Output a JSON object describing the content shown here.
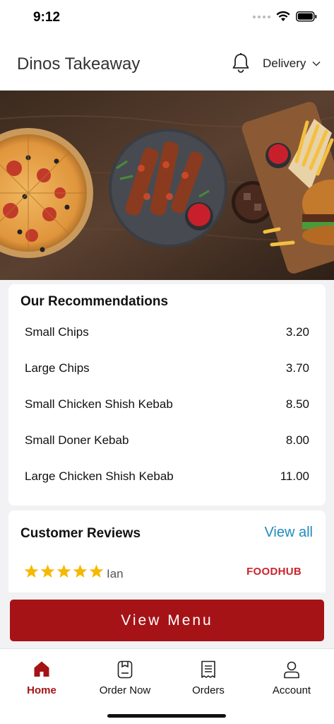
{
  "status_bar": {
    "time": "9:12"
  },
  "header": {
    "title": "Dinos Takeaway",
    "delivery_label": "Delivery"
  },
  "recommendations": {
    "title": "Our Recommendations",
    "items": [
      {
        "name": "Small Chips",
        "price": "3.20"
      },
      {
        "name": "Large Chips",
        "price": "3.70"
      },
      {
        "name": "Small Chicken Shish Kebab",
        "price": "8.50"
      },
      {
        "name": "Small Doner Kebab",
        "price": "8.00"
      },
      {
        "name": "Large Chicken Shish Kebab",
        "price": "11.00"
      }
    ]
  },
  "reviews": {
    "title": "Customer Reviews",
    "view_all_label": "View all",
    "items": [
      {
        "stars": 5,
        "reviewer": "Ian",
        "source": "FOODHUB"
      }
    ]
  },
  "cta": {
    "label": "View Menu"
  },
  "tabs": [
    {
      "label": "Home",
      "icon": "home-icon",
      "active": true
    },
    {
      "label": "Order Now",
      "icon": "order-now-icon",
      "active": false
    },
    {
      "label": "Orders",
      "icon": "receipt-icon",
      "active": false
    },
    {
      "label": "Account",
      "icon": "account-icon",
      "active": false
    }
  ],
  "colors": {
    "brand": "#a51316",
    "link": "#1f8bbf",
    "star": "#f6b900",
    "foodhub": "#c8242c"
  }
}
